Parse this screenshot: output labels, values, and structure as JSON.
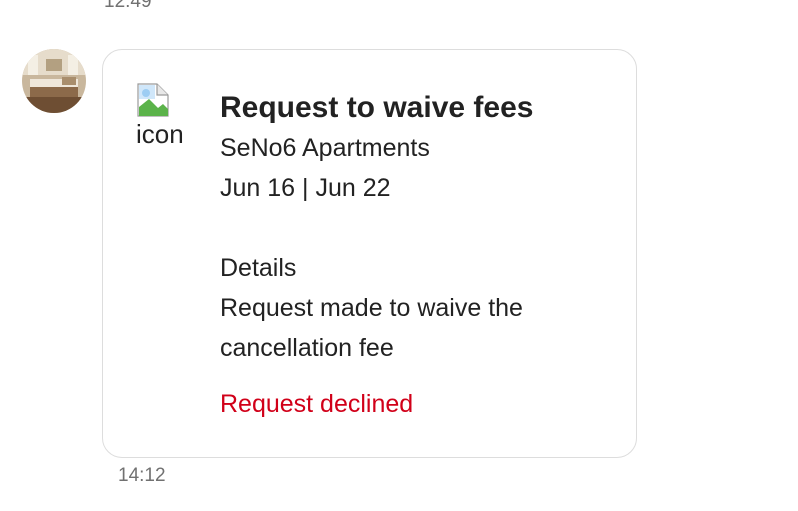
{
  "thread": {
    "previous_timestamp": "12:49",
    "message_timestamp": "14:12"
  },
  "avatar": {
    "icon": "hotel-room-photo"
  },
  "card": {
    "icon_alt": "icon",
    "title": "Request to waive fees",
    "property": "SeNo6 Apartments",
    "dates": "Jun 16 | Jun 22",
    "details_label": "Details",
    "details_line1": "Request made to waive the",
    "details_line2": "cancellation fee",
    "status": "Request declined"
  },
  "colors": {
    "status_declined": "#d10019",
    "timestamp": "#717171",
    "card_border": "#dddddd"
  }
}
